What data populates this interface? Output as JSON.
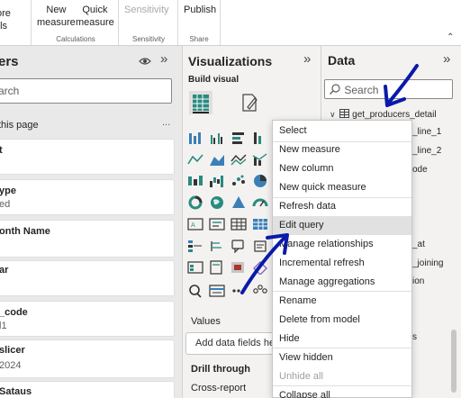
{
  "ribbon": {
    "partial_top": "ore",
    "partial_bottom": "als",
    "new_measure": "New\nmeasure",
    "quick_measure": "Quick\nmeasure",
    "sensitivity": "Sensitivity",
    "publish": "Publish",
    "group_calculations": "Calculations",
    "group_sensitivity": "Sensitivity",
    "group_share": "Share"
  },
  "filters": {
    "title": "ers",
    "search_placeholder": "arch",
    "section_label": "this page",
    "more": "...",
    "cards": [
      {
        "title": "t",
        "sub": ""
      },
      {
        "title": "ype",
        "sub": "ed"
      },
      {
        "title": "onth Name",
        "sub": ""
      },
      {
        "title": "ar",
        "sub": ""
      },
      {
        "title": "_code",
        "sub": "l1"
      },
      {
        "title": "slicer",
        "sub": "2024"
      },
      {
        "title": "Sataus",
        "sub": ""
      }
    ]
  },
  "viz": {
    "title": "Visualizations",
    "build_visual": "Build visual",
    "values_label": "Values",
    "values_placeholder": "Add data fields her",
    "drill_through": "Drill through",
    "cross_report": "Cross-report"
  },
  "data": {
    "title": "Data",
    "search_placeholder": "Search",
    "table_name": "get_producers_detail",
    "fields": [
      "_line_1",
      "_line_2",
      "ode",
      "_at",
      "_joining",
      "ion",
      "s"
    ]
  },
  "context_menu": {
    "items": [
      {
        "label": "Select",
        "state": "normal"
      },
      {
        "label": "New measure",
        "state": "normal"
      },
      {
        "label": "New column",
        "state": "normal"
      },
      {
        "label": "New quick measure",
        "state": "normal"
      },
      {
        "label": "Refresh data",
        "state": "normal"
      },
      {
        "label": "Edit query",
        "state": "highlighted"
      },
      {
        "label": "Manage relationships",
        "state": "normal"
      },
      {
        "label": "Incremental refresh",
        "state": "normal"
      },
      {
        "label": "Manage aggregations",
        "state": "normal"
      },
      {
        "label": "Rename",
        "state": "normal"
      },
      {
        "label": "Delete from model",
        "state": "normal"
      },
      {
        "label": "Hide",
        "state": "normal"
      },
      {
        "label": "View hidden",
        "state": "normal"
      },
      {
        "label": "Unhide all",
        "state": "disabled"
      },
      {
        "label": "Collapse all",
        "state": "normal"
      }
    ]
  },
  "colors": {
    "annotation_arrow": "#0a1aa8",
    "viz_teal": "#2a8a80",
    "highlight": "#e1e1e1"
  },
  "icons": [
    "eye-icon",
    "collapse-chevron-icon",
    "search-icon",
    "table-icon",
    "expand-chevron-icon",
    "build-visual-icon",
    "format-visual-icon"
  ]
}
